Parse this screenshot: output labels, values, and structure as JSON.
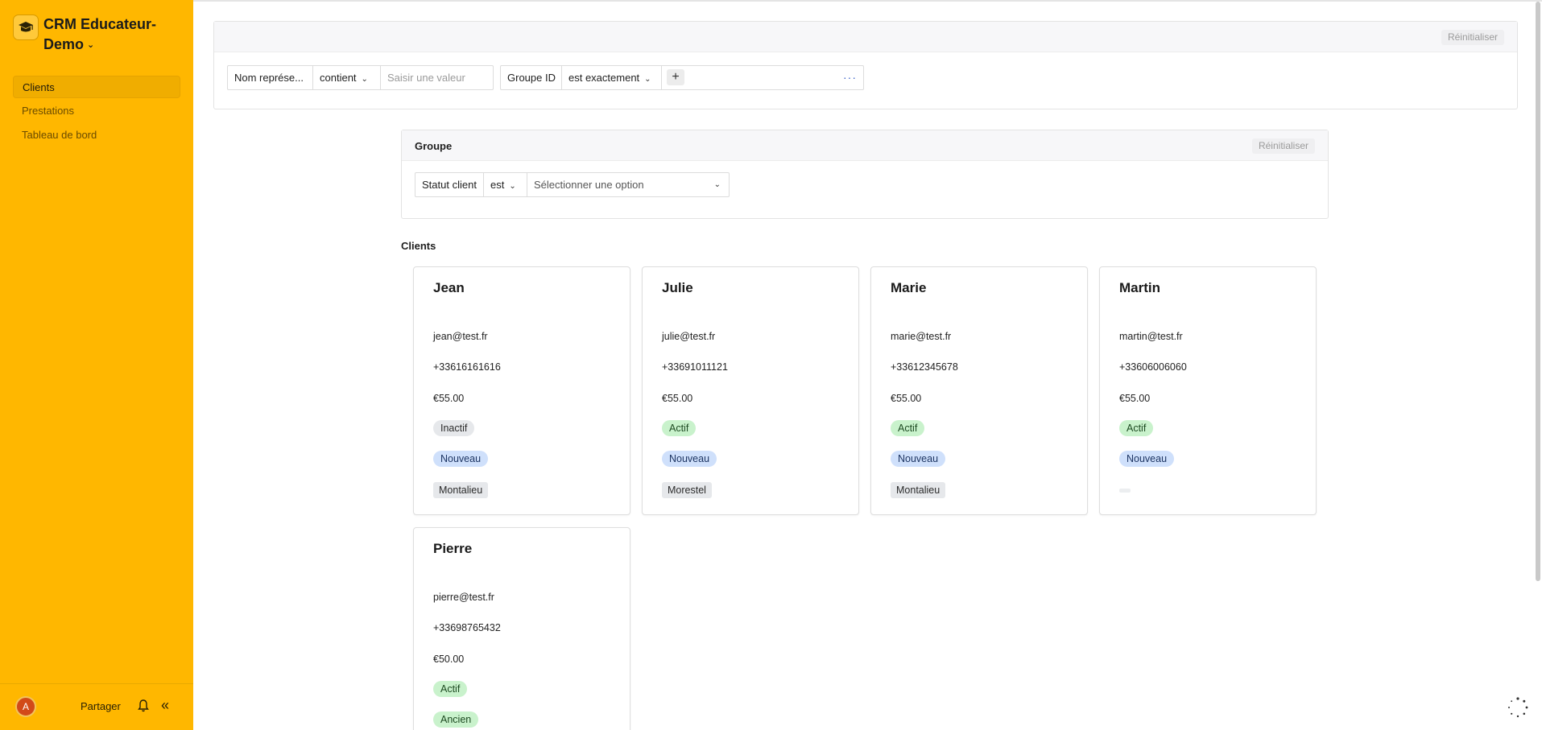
{
  "app": {
    "name": "CRM Educateur-Demo",
    "brand_icon": "graduation-cap-icon"
  },
  "sidebar": {
    "items": [
      {
        "label": "Clients",
        "active": true
      },
      {
        "label": "Prestations",
        "active": false
      },
      {
        "label": "Tableau de bord",
        "active": false
      }
    ],
    "footer": {
      "avatar_initial": "A",
      "share_label": "Partager",
      "notification_icon": "bell-icon",
      "collapse_icon": "double-chevron-left-icon"
    }
  },
  "filters_top": {
    "reset_label": "Réinitialiser",
    "filter1": {
      "field": "Nom représe...",
      "operator": "contient",
      "placeholder": "Saisir une valeur"
    },
    "filter2": {
      "field": "Groupe ID",
      "operator": "est exactement",
      "add_icon": "plus-icon",
      "more_icon": "ellipsis-icon"
    }
  },
  "filters_group": {
    "title": "Groupe",
    "reset_label": "Réinitialiser",
    "filter": {
      "field": "Statut client",
      "operator": "est",
      "placeholder": "Sélectionner une option"
    }
  },
  "clients_section": {
    "title": "Clients",
    "cards": [
      {
        "name": "Jean",
        "email": "jean@test.fr",
        "phone": "+33616161616",
        "price": "€55.00",
        "status": "Inactif",
        "type": "Nouveau",
        "city": "Montalieu"
      },
      {
        "name": "Julie",
        "email": "julie@test.fr",
        "phone": "+33691011121",
        "price": "€55.00",
        "status": "Actif",
        "type": "Nouveau",
        "city": "Morestel"
      },
      {
        "name": "Marie",
        "email": "marie@test.fr",
        "phone": "+33612345678",
        "price": "€55.00",
        "status": "Actif",
        "type": "Nouveau",
        "city": "Montalieu"
      },
      {
        "name": "Martin",
        "email": "martin@test.fr",
        "phone": "+33606006060",
        "price": "€55.00",
        "status": "Actif",
        "type": "Nouveau",
        "city": ""
      },
      {
        "name": "Pierre",
        "email": "pierre@test.fr",
        "phone": "+33698765432",
        "price": "€50.00",
        "status": "Actif",
        "type": "Ancien",
        "city": ""
      }
    ]
  },
  "colors": {
    "sidebar_bg": "#ffb700",
    "tag_actif": "#c9f2cc",
    "tag_nouveau": "#cfe0fb",
    "tag_inactif": "#e6e8eb",
    "avatar_bg": "#d24a19"
  },
  "misc": {
    "loading_icon": "spinner-icon"
  }
}
